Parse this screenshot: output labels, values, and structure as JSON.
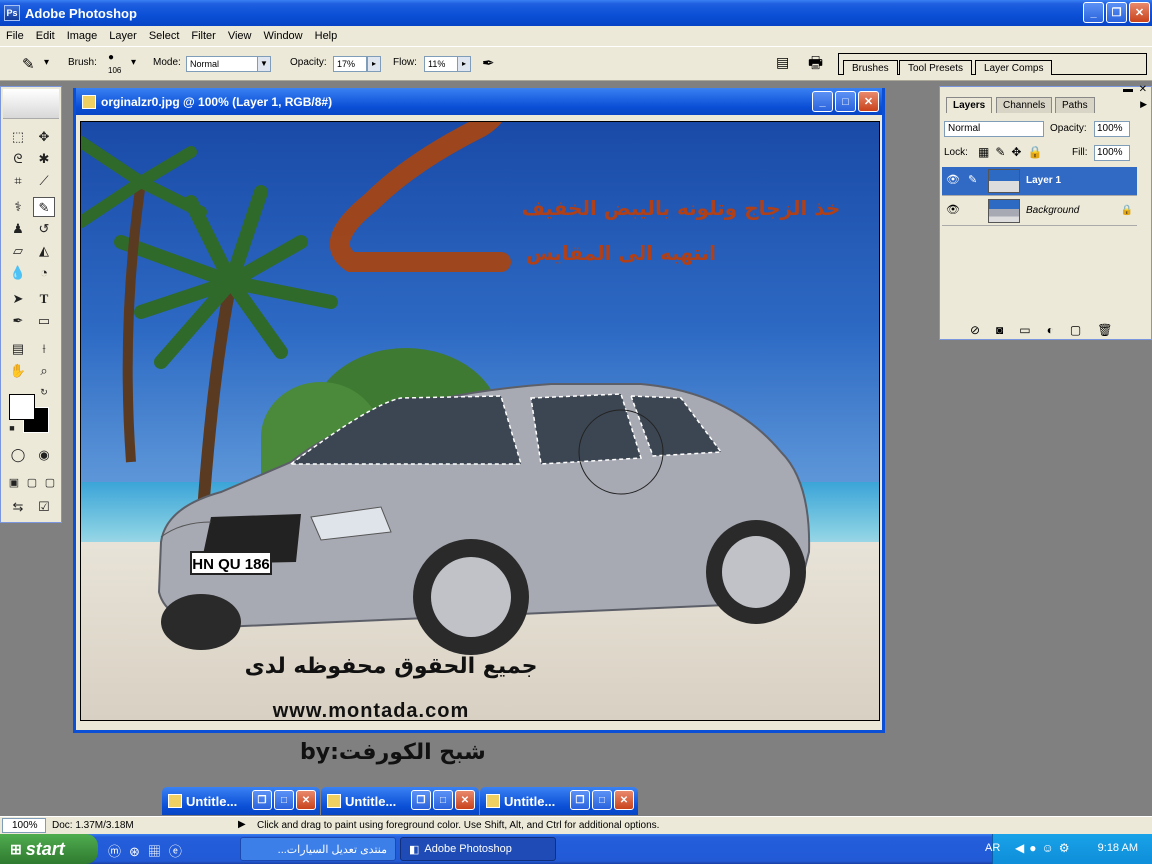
{
  "app": {
    "title": "Adobe Photoshop",
    "icon": "photoshop-icon"
  },
  "menu": [
    "File",
    "Edit",
    "Image",
    "Layer",
    "Select",
    "Filter",
    "View",
    "Window",
    "Help"
  ],
  "options": {
    "brush_label": "Brush:",
    "brush_size": "106",
    "mode_label": "Mode:",
    "mode_value": "Normal",
    "opacity_label": "Opacity:",
    "opacity_value": "17%",
    "flow_label": "Flow:",
    "flow_value": "11%"
  },
  "palette_well": [
    "Brushes",
    "Tool Presets",
    "Layer Comps"
  ],
  "document": {
    "title": "orginalzr0.jpg @ 100% (Layer 1, RGB/8#)",
    "plate": "HN QU 186",
    "overlay_line1": "خذ الزجاج وتلونه باليبض الخفيف",
    "overlay_line2": "انتهبه الى المقايس",
    "rights": "جميع الحقوق محفوظه لدى",
    "website": "www.montada.com"
  },
  "byline": "by:شبح الكورفت",
  "layers_panel": {
    "tabs": [
      "Layers",
      "Channels",
      "Paths"
    ],
    "blend_mode": "Normal",
    "opacity_label": "Opacity:",
    "opacity_value": "100%",
    "lock_label": "Lock:",
    "fill_label": "Fill:",
    "fill_value": "100%",
    "layers": [
      {
        "name": "Layer 1",
        "selected": true
      },
      {
        "name": "Background",
        "selected": false
      }
    ]
  },
  "minimized_docs": [
    "Untitle...",
    "Untitle...",
    "Untitle..."
  ],
  "status": {
    "zoom": "100%",
    "doc": "Doc: 1.37M/3.18M",
    "hint": "Click and drag to paint using foreground color.  Use Shift, Alt, and Ctrl for additional options."
  },
  "taskbar": {
    "start": "start",
    "tasks": [
      "منتدى تعديل السيارات...",
      "Adobe Photoshop"
    ],
    "lang": "AR",
    "time": "9:18 AM"
  },
  "colors": {
    "xp_blue": "#0a4fd6",
    "panel_bg": "#ece9d8",
    "workspace": "#808080",
    "annotation": "#a84410"
  }
}
